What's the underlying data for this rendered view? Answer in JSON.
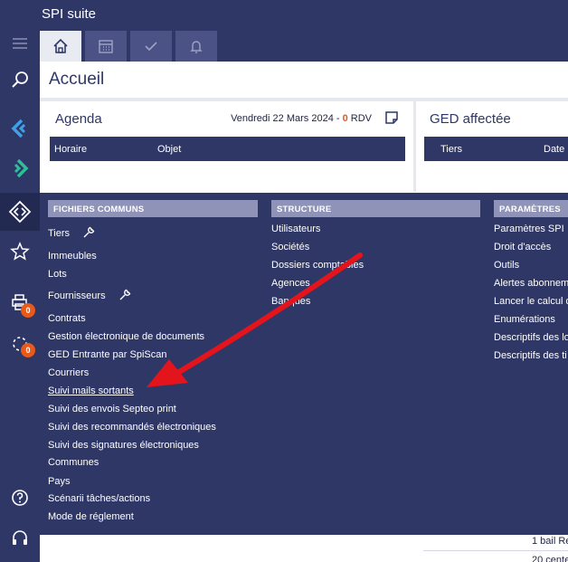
{
  "app": {
    "title": "SPI suite"
  },
  "tabs": [
    {
      "icon": "home-icon"
    },
    {
      "icon": "calendar-icon"
    },
    {
      "icon": "checkmark-icon"
    },
    {
      "icon": "bell-icon"
    }
  ],
  "rail": {
    "badge_printer": "0",
    "badge_sync": "0"
  },
  "page": {
    "title": "Accueil"
  },
  "agenda": {
    "title": "Agenda",
    "date": "Vendredi 22 Mars 2024",
    "separator": " - ",
    "count": "0",
    "unit": " RDV",
    "col_horaire": "Horaire",
    "col_objet": "Objet"
  },
  "ged": {
    "title": "GED affectée",
    "col_tiers": "Tiers",
    "col_date": "Date"
  },
  "bottom": {
    "line1": "1 bail Re",
    "line2": "20 cente"
  },
  "menu": {
    "fichiers_communs": {
      "header": "FICHIERS COMMUNS",
      "items": [
        "Tiers",
        "Immeubles",
        "Lots",
        "Fournisseurs",
        "Contrats",
        "Gestion électronique de documents",
        "GED Entrante par SpiScan",
        "Courriers",
        "Suivi mails sortants",
        "Suivi des envois Septeo print",
        "Suivi des recommandés électroniques",
        "Suivi des signatures électroniques",
        "Communes",
        "Pays",
        "Scénarii tâches/actions",
        "Mode de réglement"
      ]
    },
    "structure": {
      "header": "STRUCTURE",
      "items": [
        "Utilisateurs",
        "Sociétés",
        "Dossiers comptables",
        "Agences",
        "Banques"
      ]
    },
    "parametres": {
      "header": "PARAMÈTRES",
      "items": [
        "Paramètres SPI",
        "Droit d'accès",
        "Outils",
        "Alertes abonnem",
        "Lancer le calcul d",
        "Enumérations",
        "Descriptifs des lo",
        "Descriptifs des ti"
      ]
    }
  },
  "colors": {
    "navy": "#2f3766",
    "accent_orange": "#e8591a",
    "menu_header": "#8e93b7",
    "arrow_red": "#e3141b"
  }
}
